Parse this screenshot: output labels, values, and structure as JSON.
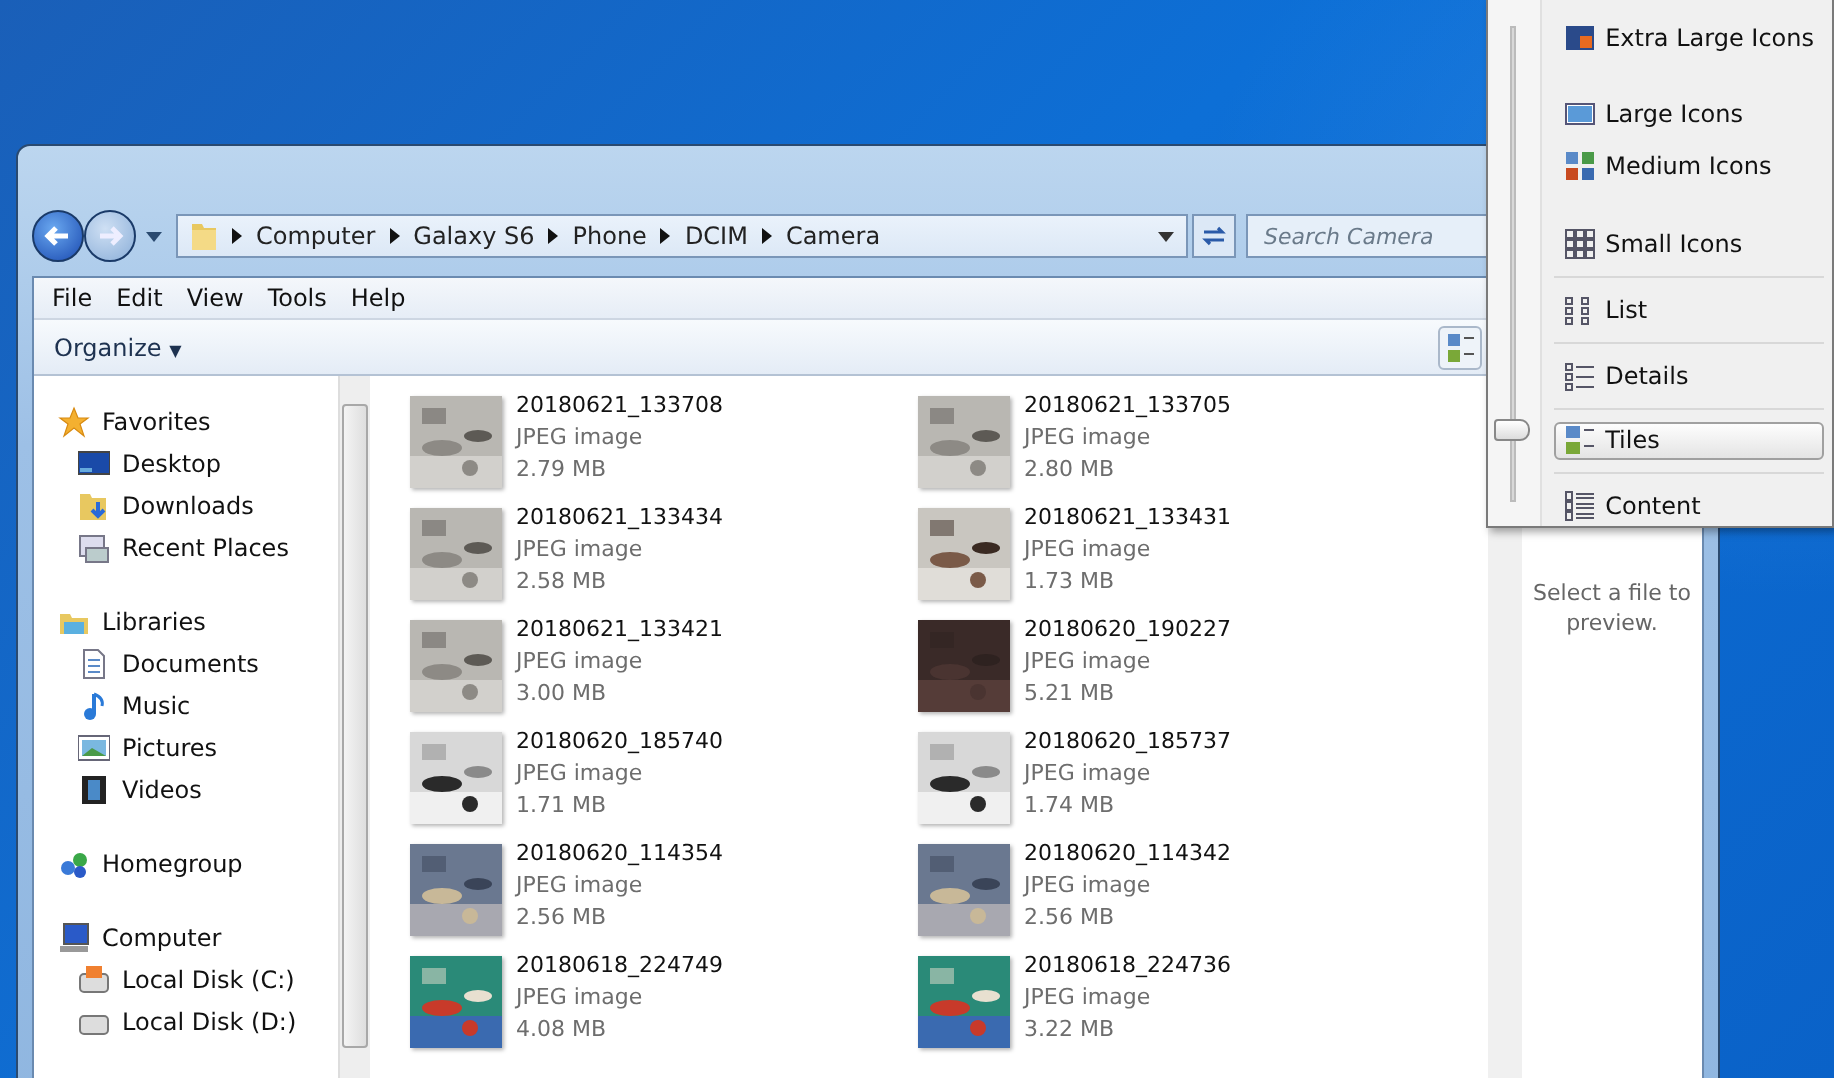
{
  "address_bar": {
    "breadcrumbs": [
      "Computer",
      "Galaxy S6",
      "Phone",
      "DCIM",
      "Camera"
    ]
  },
  "search": {
    "placeholder": "Search Camera"
  },
  "menu_bar": [
    "File",
    "Edit",
    "View",
    "Tools",
    "Help"
  ],
  "toolbar": {
    "organize": "Organize",
    "organize_caret": "▼"
  },
  "navigation": [
    {
      "label": "Favorites",
      "children": [
        {
          "label": "Desktop"
        },
        {
          "label": "Downloads"
        },
        {
          "label": "Recent Places"
        }
      ]
    },
    {
      "label": "Libraries",
      "children": [
        {
          "label": "Documents"
        },
        {
          "label": "Music"
        },
        {
          "label": "Pictures"
        },
        {
          "label": "Videos"
        }
      ]
    },
    {
      "label": "Homegroup"
    },
    {
      "label": "Computer",
      "children": [
        {
          "label": "Local Disk (C:)"
        },
        {
          "label": "Local Disk (D:)"
        }
      ]
    }
  ],
  "files": [
    {
      "name": "20180621_133708",
      "type": "JPEG image",
      "size": "2.79 MB"
    },
    {
      "name": "20180621_133705",
      "type": "JPEG image",
      "size": "2.80 MB"
    },
    {
      "name": "20180621_133434",
      "type": "JPEG image",
      "size": "2.58 MB"
    },
    {
      "name": "20180621_133431",
      "type": "JPEG image",
      "size": "1.73 MB"
    },
    {
      "name": "20180621_133421",
      "type": "JPEG image",
      "size": "3.00 MB"
    },
    {
      "name": "20180620_190227",
      "type": "JPEG image",
      "size": "5.21 MB"
    },
    {
      "name": "20180620_185740",
      "type": "JPEG image",
      "size": "1.71 MB"
    },
    {
      "name": "20180620_185737",
      "type": "JPEG image",
      "size": "1.74 MB"
    },
    {
      "name": "20180620_114354",
      "type": "JPEG image",
      "size": "2.56 MB"
    },
    {
      "name": "20180620_114342",
      "type": "JPEG image",
      "size": "2.56 MB"
    },
    {
      "name": "20180618_224749",
      "type": "JPEG image",
      "size": "4.08 MB"
    },
    {
      "name": "20180618_224736",
      "type": "JPEG image",
      "size": "3.22 MB"
    }
  ],
  "preview": {
    "message": "Select a file to preview."
  },
  "view_menu": {
    "slider": {
      "level": 0.15
    },
    "items": [
      {
        "label": "Extra Large Icons",
        "selected": false
      },
      {
        "label": "Large Icons",
        "selected": false
      },
      {
        "label": "Medium Icons",
        "selected": false
      },
      {
        "label": "Small Icons",
        "selected": false
      },
      {
        "label": "List",
        "selected": false
      },
      {
        "label": "Details",
        "selected": false
      },
      {
        "label": "Tiles",
        "selected": true
      },
      {
        "label": "Content",
        "selected": false
      }
    ]
  }
}
